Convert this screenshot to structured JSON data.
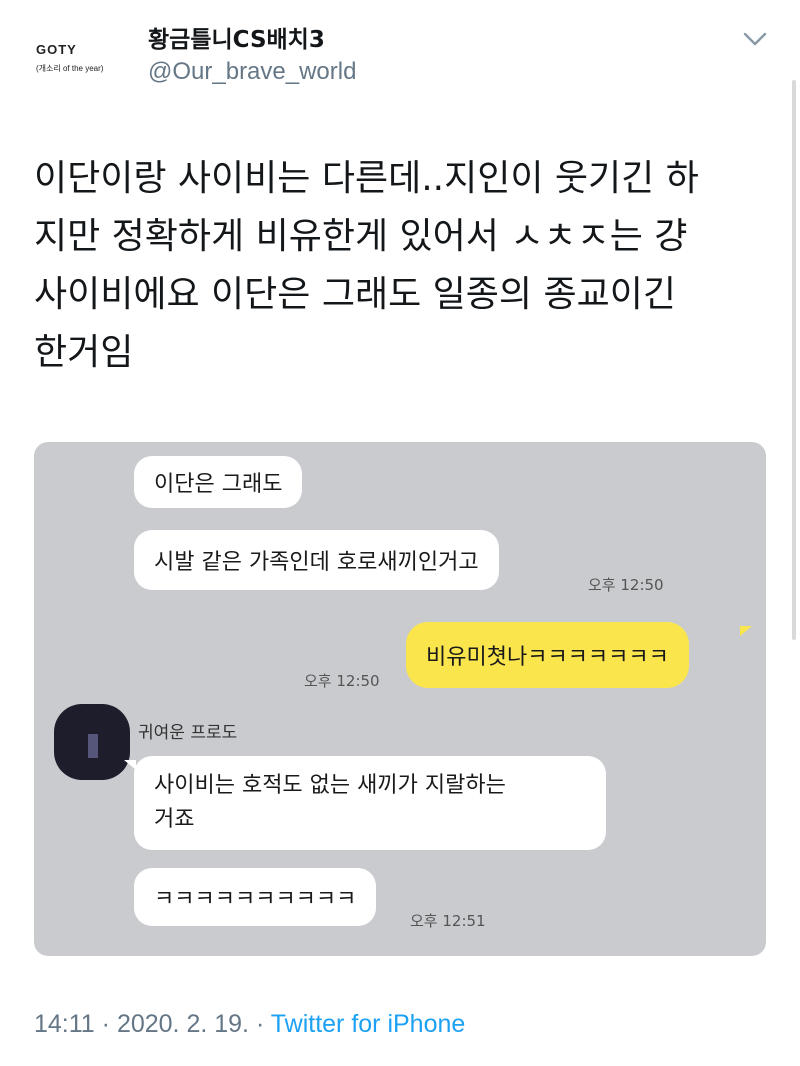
{
  "header": {
    "avatar_title": "GOTY",
    "avatar_subtitle": "(개소리 of the year)",
    "display_name": "황금틀니CS배치3",
    "handle": "@Our_brave_world"
  },
  "tweet": {
    "text": "이단이랑 사이비는 다른데..지인이 웃기긴 하\n지만 정확하게 비유한게 있어서 ㅅㅊㅈ는 걍\n사이비에요 이단은 그래도 일종의 종교이긴\n한거임"
  },
  "chat": {
    "messages": {
      "m1": "이단은 그래도",
      "m2": "시발 같은 가족인데 호로새끼인거고",
      "t1": "오후 12:50",
      "m3": "비유미쳣나ㅋㅋㅋㅋㅋㅋㅋ",
      "t2": "오후 12:50",
      "friend_name": "귀여운 프로도",
      "m4": "사이비는 호적도 없는 새끼가 지랄하는\n거죠",
      "m5": "ㅋㅋㅋㅋㅋㅋㅋㅋㅋㅋ",
      "t3": "오후 12:51"
    }
  },
  "footer": {
    "time": "14:11",
    "sep1": " · ",
    "date": "2020. 2. 19.",
    "sep2": " · ",
    "source": "Twitter for iPhone"
  },
  "colors": {
    "chat_background": "#c9cbcf",
    "my_bubble": "#fbe54d",
    "other_bubble": "#ffffff",
    "link_blue": "#1da1f2",
    "secondary_text": "#657786"
  }
}
